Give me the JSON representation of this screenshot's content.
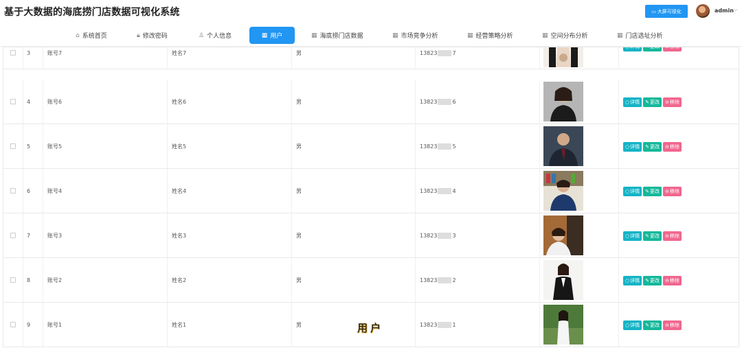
{
  "header": {
    "title": "基于大数据的海底捞门店数据可视化系统",
    "bigscreen_label": "大屏可视化",
    "user_name": "admin"
  },
  "nav": {
    "items": [
      {
        "label": "系统首页",
        "icon": "home-icon",
        "active": false
      },
      {
        "label": "修改密码",
        "icon": "lock-icon",
        "active": false
      },
      {
        "label": "个人信息",
        "icon": "user-icon",
        "active": false
      },
      {
        "label": "用户",
        "icon": "grid-icon",
        "active": true
      },
      {
        "label": "海底捞门店数据",
        "icon": "grid-icon",
        "active": false
      },
      {
        "label": "市场竞争分析",
        "icon": "grid-icon",
        "active": false
      },
      {
        "label": "经营策略分析",
        "icon": "grid-icon",
        "active": false
      },
      {
        "label": "空间分布分析",
        "icon": "grid-icon",
        "active": false
      },
      {
        "label": "门店选址分析",
        "icon": "grid-icon",
        "active": false
      }
    ]
  },
  "table": {
    "rows": [
      {
        "index": "3",
        "account": "账号7",
        "name": "姓名7",
        "sex": "男",
        "phone_prefix": "13823",
        "phone_suffix": "7"
      },
      {
        "index": "4",
        "account": "账号6",
        "name": "姓名6",
        "sex": "男",
        "phone_prefix": "13823",
        "phone_suffix": "6"
      },
      {
        "index": "5",
        "account": "账号5",
        "name": "姓名5",
        "sex": "男",
        "phone_prefix": "13823",
        "phone_suffix": "5"
      },
      {
        "index": "6",
        "account": "账号4",
        "name": "姓名4",
        "sex": "男",
        "phone_prefix": "13823",
        "phone_suffix": "4"
      },
      {
        "index": "7",
        "account": "账号3",
        "name": "姓名3",
        "sex": "男",
        "phone_prefix": "13823",
        "phone_suffix": "3"
      },
      {
        "index": "8",
        "account": "账号2",
        "name": "姓名2",
        "sex": "男",
        "phone_prefix": "13823",
        "phone_suffix": "2"
      },
      {
        "index": "9",
        "account": "账号1",
        "name": "姓名1",
        "sex": "男",
        "phone_prefix": "13823",
        "phone_suffix": "1"
      }
    ],
    "actions": {
      "detail": "详情",
      "edit": "更改",
      "delete": "移除"
    }
  },
  "watermark": "用户",
  "colors": {
    "primary": "#2196f3",
    "detail": "#14b4c6",
    "edit": "#14b89a",
    "delete": "#f0668e"
  }
}
